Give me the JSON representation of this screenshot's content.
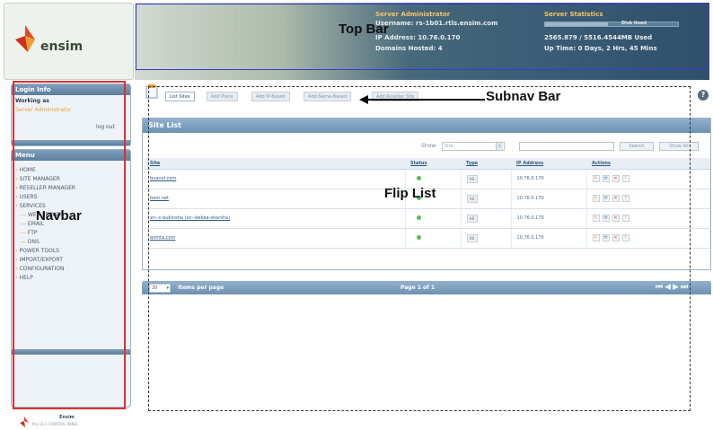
{
  "annotations": {
    "top_bar": "Top Bar",
    "subnav_bar": "Subnav Bar",
    "flip_list": "Flip List",
    "navbar": "Navbar"
  },
  "logo": {
    "text": "ensim",
    "icon": "ensim-logo-icon"
  },
  "topbar": {
    "server_admin": "Server Administrator",
    "user_line": "Username: rs-1b01.rtls.ensim.com",
    "ip_line": "IP Address: 10.76.0.170",
    "domains_line": "Domains Hosted: 4",
    "stats_title": "Server Statistics",
    "stats_bar_label": "Disk Used",
    "stats_used": "2565.879 / 5516.4544MB Used",
    "uptime": "Up Time: 0 Days, 2 Hrs, 45 Mins",
    "disk_used_fraction": 0.47
  },
  "login_info": {
    "header": "Login Info",
    "working_as": "Working as",
    "role": "Server Administrator",
    "logout": "log out"
  },
  "menu": {
    "header": "Menu",
    "items": [
      "HOME",
      "SITE MANAGER",
      "RESELLER MANAGER",
      "USERS",
      "SERVICES",
      "WEB SERVER",
      "EMAIL",
      "FTP",
      "DNS",
      "POWER TOOLS",
      "IMPORT/EXPORT",
      "CONFIGURATION",
      "HELP"
    ]
  },
  "footer_logo": {
    "line1": "Ensim",
    "line2": "Pro 10.3 CONTROL PANEL"
  },
  "subnav": {
    "tabs": [
      "List Sites",
      "Add Plans",
      "Add IP-Based",
      "Add Name-Based",
      "Add Reseller Site"
    ],
    "help_icon": "help-icon"
  },
  "site_list": {
    "title": "Site List",
    "show_label": "Show:",
    "show_value": "Site",
    "search_button": "Search",
    "show_all_button": "Show All",
    "columns": [
      "Site",
      "Status",
      "Type",
      "IP Address",
      "Actions"
    ],
    "rows": [
      {
        "site": "buanol.com",
        "type": "NB",
        "ip": "10.76.0.170"
      },
      {
        "site": "bom.net",
        "type": "NB",
        "ip": "10.76.0.170"
      },
      {
        "site": "xn--c-bukinsha (xn--bekba-sharsha)",
        "type": "NB",
        "ip": "10.76.0.170"
      },
      {
        "site": "anmta.com",
        "type": "NB",
        "ip": "10.76.0.170"
      }
    ],
    "per_page_value": "20",
    "per_page_label": "Items per page",
    "page_info": "Page 1 of 1"
  }
}
